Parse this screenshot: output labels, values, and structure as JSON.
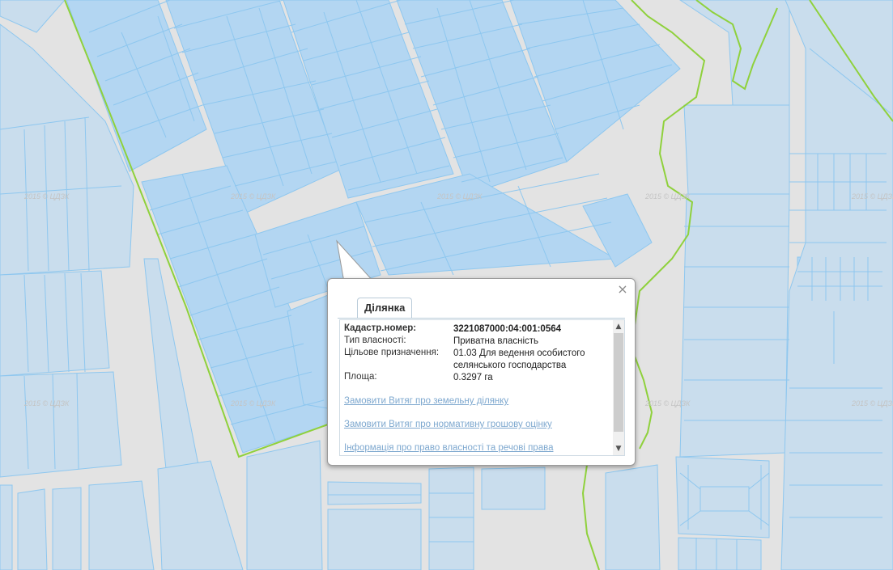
{
  "map": {
    "watermark_text": "2015 © ЦДЗК",
    "colors": {
      "background": "#e3e3e3",
      "parcel_fill": "#c9dded",
      "parcel_fill_selected": "#b3d6f2",
      "parcel_stroke": "#8ec7ef",
      "boundary": "#8fd13c"
    }
  },
  "popup": {
    "tab_label": "Ділянка",
    "close_symbol": "×",
    "fields": [
      {
        "label": "Кадастр.номер:",
        "value": "3221087000:04:001:0564"
      },
      {
        "label": "Тип власності:",
        "value": "Приватна власність"
      },
      {
        "label": "Цільове призначення:",
        "value": "01.03 Для ведення особистого селянського господарства"
      },
      {
        "label": "Площа:",
        "value": "0.3297 га"
      }
    ],
    "links": [
      "Замовити Витяг про земельну ділянку",
      "Замовити Витяг про нормативну грошову оцінку",
      "Інформація про право власності та речові права"
    ],
    "scroll_up": "▲",
    "scroll_down": "▼"
  }
}
